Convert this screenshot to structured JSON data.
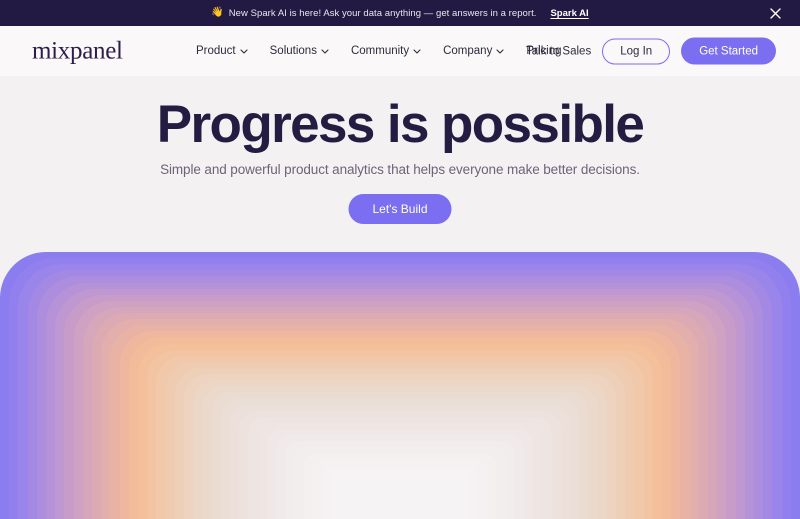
{
  "banner": {
    "emoji": "👋",
    "emoji_name": "waving-hand-emoji",
    "text": "New Spark AI is here! Ask your data anything — get answers in a report.",
    "link_label": "Spark AI",
    "close_label": "×",
    "background": "#231a43"
  },
  "header": {
    "logo": "mixpanel",
    "nav": [
      {
        "label": "Product",
        "has_dropdown": true
      },
      {
        "label": "Solutions",
        "has_dropdown": true
      },
      {
        "label": "Community",
        "has_dropdown": true
      },
      {
        "label": "Company",
        "has_dropdown": true
      },
      {
        "label": "Pricing",
        "has_dropdown": false
      }
    ],
    "talk_to_sales": "Talk to Sales",
    "login": "Log In",
    "get_started": "Get Started",
    "background": "#faf8f9"
  },
  "hero": {
    "title": "Progress is possible",
    "subtitle": "Simple and powerful product analytics that helps everyone make better decisions.",
    "cta": "Let's Build",
    "title_color": "#251c42",
    "background": "#f4f1f3"
  },
  "theme": {
    "accent": "#7b6ef0",
    "dark": "#231a43",
    "page_background": "#f4f1f3"
  },
  "arch": {
    "name": "concentric-gradient-arch",
    "band_colors": [
      "#8b7cf0",
      "#9180ee",
      "#9a85ea",
      "#a389e4",
      "#ad8ede",
      "#b693d8",
      "#bf97d1",
      "#c79cc9",
      "#cfa1c2",
      "#d6a6bb",
      "#dcaab3",
      "#e2afac",
      "#e8b3a5",
      "#eeb79e",
      "#f2bb9a",
      "#f4bf9b",
      "#f3c4a2",
      "#f1c8a9",
      "#efccb1",
      "#eed0b9",
      "#edd3c0",
      "#ecd6c6",
      "#ebd9cc",
      "#ebdcd2",
      "#ebded7",
      "#ece0db",
      "#ede2de",
      "#eee4e1",
      "#efe6e4",
      "#f0e8e7",
      "#f1eaea",
      "#f2ecec",
      "#f3eeee",
      "#f4f0f0",
      "#f5f1f2",
      "#f5f2f3",
      "#f6f3f4",
      "#f6f3f4"
    ]
  }
}
